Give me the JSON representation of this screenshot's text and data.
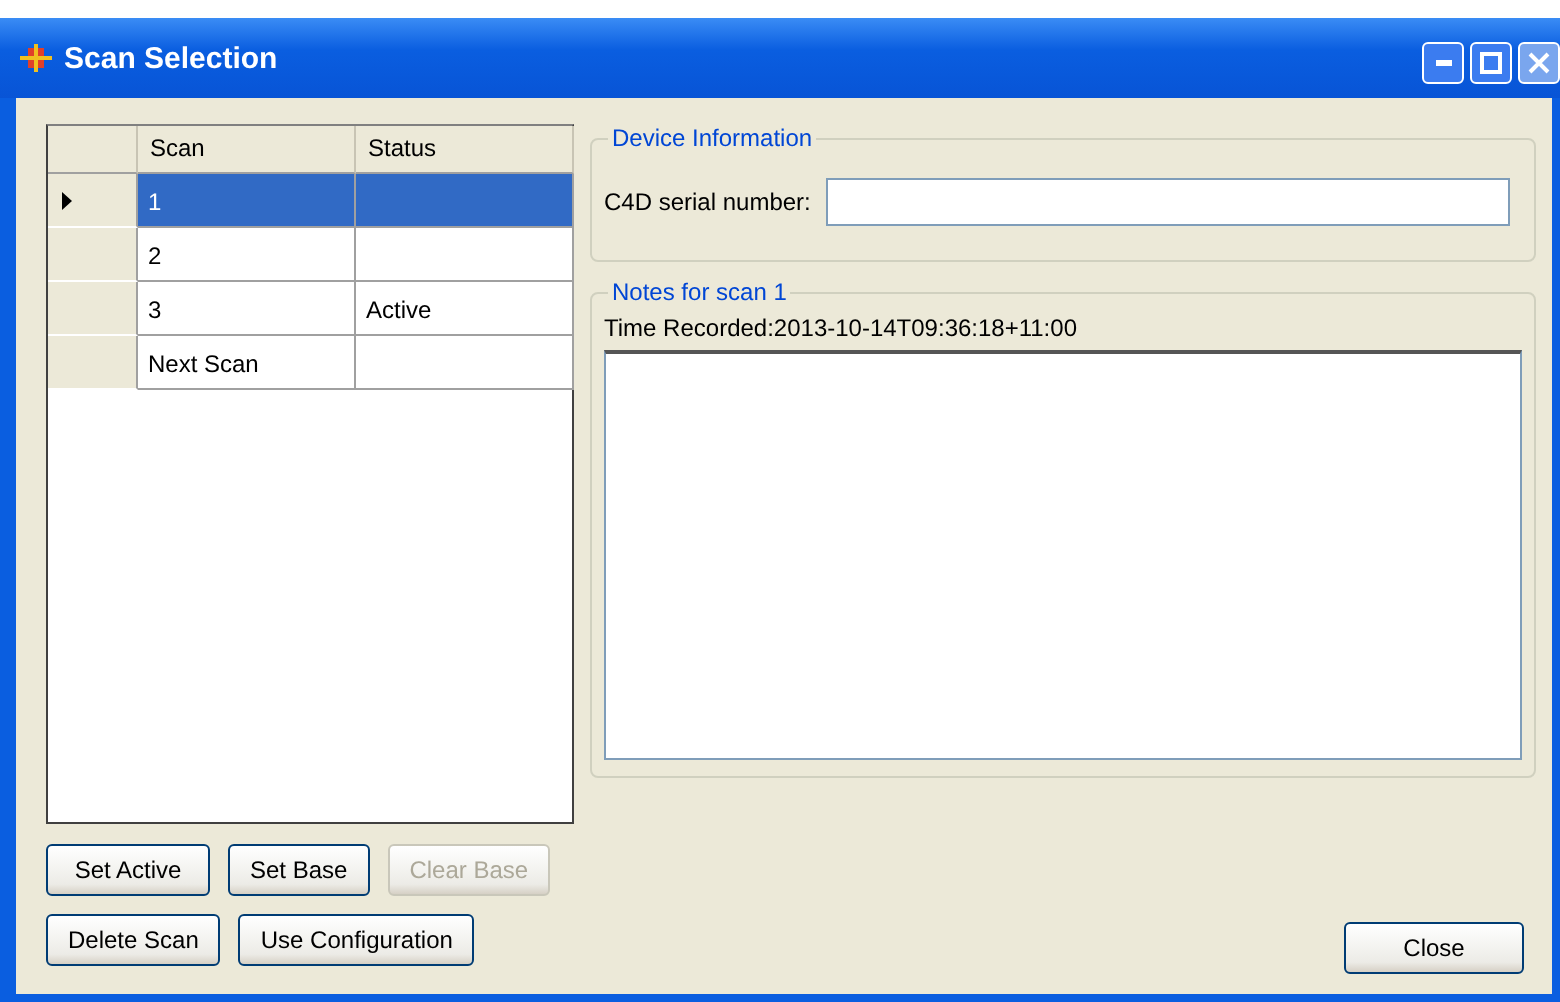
{
  "window": {
    "title": "Scan Selection"
  },
  "table": {
    "columns": [
      "Scan",
      "Status"
    ],
    "rows": [
      {
        "cells": [
          "1",
          ""
        ],
        "selected": true
      },
      {
        "cells": [
          "2",
          ""
        ],
        "selected": false
      },
      {
        "cells": [
          "3",
          "Active"
        ],
        "selected": false
      },
      {
        "cells": [
          "Next Scan",
          ""
        ],
        "selected": false
      }
    ]
  },
  "left_buttons": [
    [
      {
        "label": "Set Active",
        "disabled": false
      },
      {
        "label": "Set Base",
        "disabled": false
      },
      {
        "label": "Clear Base",
        "disabled": true
      }
    ],
    [
      {
        "label": "Delete Scan",
        "disabled": false
      },
      {
        "label": "Use Configuration",
        "disabled": false
      }
    ]
  ],
  "device_information": {
    "title": "Device Information",
    "serial_label": "C4D serial number:"
  },
  "notes": {
    "title": "Notes for scan 1",
    "time_recorded": "Time Recorded:2013-10-14T09:36:18+11:00"
  },
  "close_button": {
    "label": "Close"
  }
}
